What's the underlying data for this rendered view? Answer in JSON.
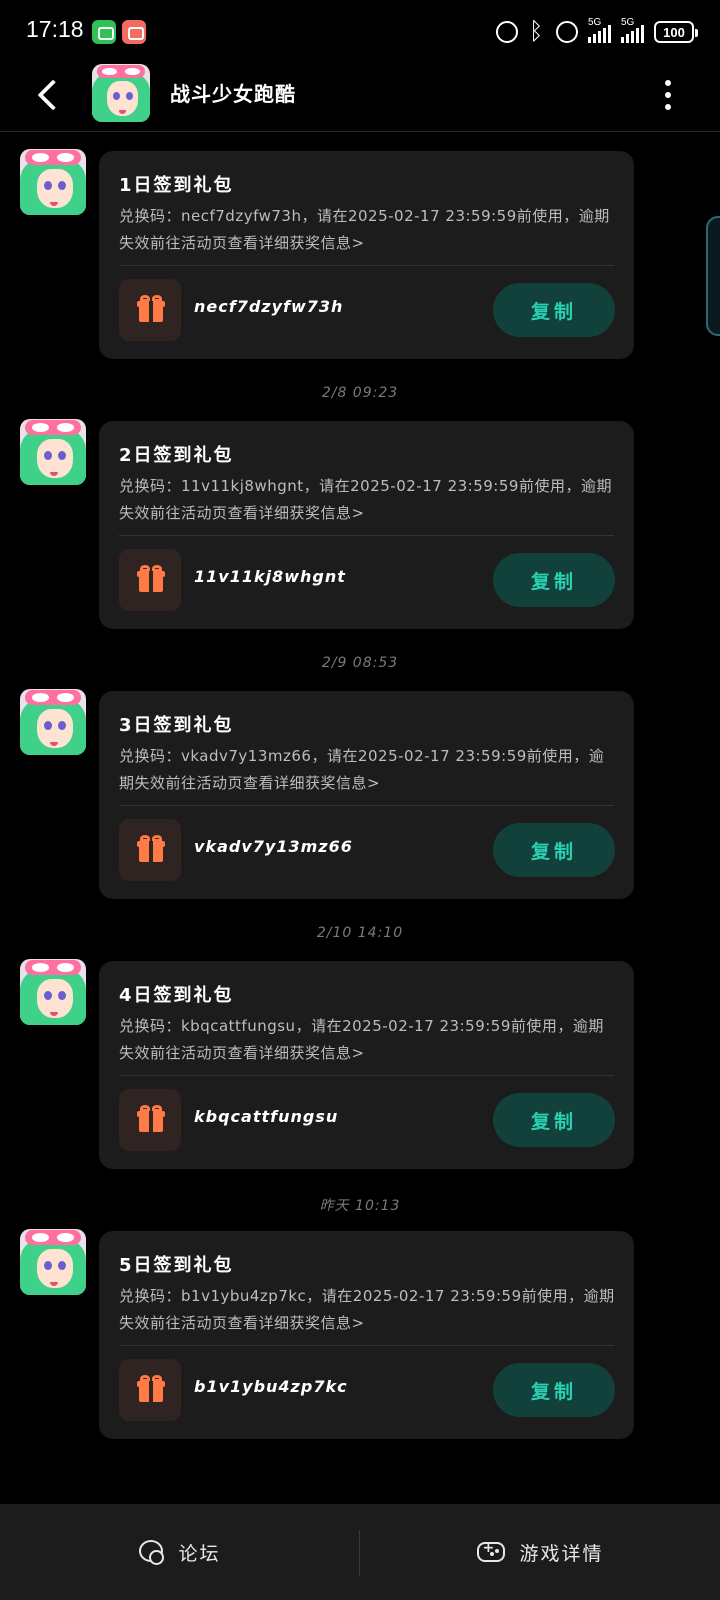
{
  "status_bar": {
    "time": "17:18",
    "battery": "100",
    "network_1": "5G",
    "network_2": "5G"
  },
  "header": {
    "title": "战斗少女跑酷"
  },
  "messages": [
    {
      "title": "1日签到礼包",
      "body": "兑换码：necf7dzyfw73h，请在2025-02-17 23:59:59前使用，逾期失效前往活动页查看详细获奖信息>",
      "code": "necf7dzyfw73h",
      "copy_label": "复制"
    },
    {
      "timestamp": "2/8  09:23",
      "title": "2日签到礼包",
      "body": "兑换码：11v11kj8whgnt，请在2025-02-17 23:59:59前使用，逾期失效前往活动页查看详细获奖信息>",
      "code": "11v11kj8whgnt",
      "copy_label": "复制"
    },
    {
      "timestamp": "2/9  08:53",
      "title": "3日签到礼包",
      "body": "兑换码：vkadv7y13mz66，请在2025-02-17 23:59:59前使用，逾期失效前往活动页查看详细获奖信息>",
      "code": "vkadv7y13mz66",
      "copy_label": "复制"
    },
    {
      "timestamp": "2/10  14:10",
      "title": "4日签到礼包",
      "body": "兑换码：kbqcattfungsu，请在2025-02-17 23:59:59前使用，逾期失效前往活动页查看详细获奖信息>",
      "code": "kbqcattfungsu",
      "copy_label": "复制"
    },
    {
      "timestamp": "昨天  10:13",
      "title": "5日签到礼包",
      "body": "兑换码：b1v1ybu4zp7kc，请在2025-02-17 23:59:59前使用，逾期失效前往活动页查看详细获奖信息>",
      "code": "b1v1ybu4zp7kc",
      "copy_label": "复制"
    }
  ],
  "bottom_bar": {
    "forum_label": "论坛",
    "game_details_label": "游戏详情"
  },
  "colors": {
    "background": "#000000",
    "card": "#1c1c1c",
    "accent_teal": "#2ad0b2",
    "copy_button_bg": "#12403a",
    "gift_orange": "#ff7a45"
  }
}
